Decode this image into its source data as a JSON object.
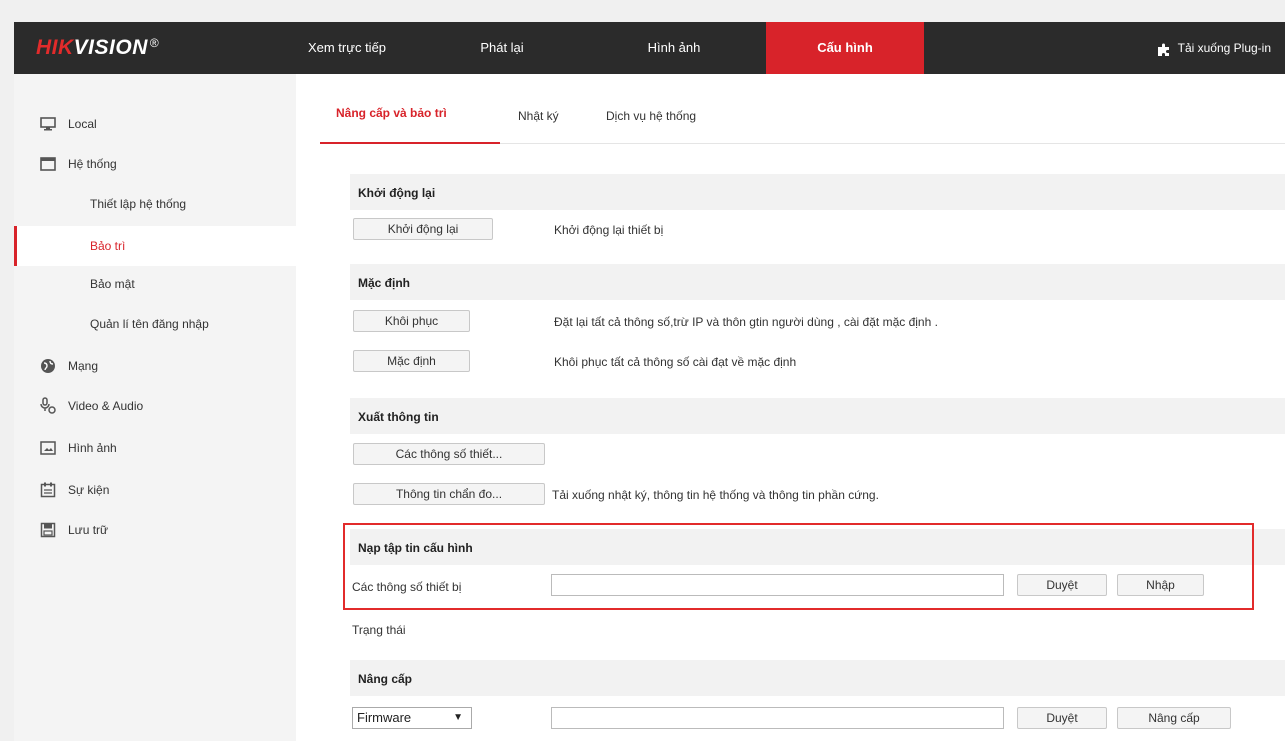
{
  "header": {
    "logo_red": "HIK",
    "logo_white": "VISION",
    "logo_mark": "®",
    "nav": [
      "Xem trực tiếp",
      "Phát lại",
      "Hình ảnh",
      "Cấu hình"
    ],
    "active_nav": "Cấu hình",
    "plugin_label": "Tải xuống Plug-in",
    "plugin_icon": "puzzle-icon"
  },
  "sidebar": {
    "items": [
      {
        "label": "Local",
        "icon": "monitor-icon"
      },
      {
        "label": "Hệ thống",
        "icon": "system-window-icon"
      },
      {
        "label": "Thiết lập hệ thống"
      },
      {
        "label": "Bảo trì"
      },
      {
        "label": "Bảo mật"
      },
      {
        "label": "Quản lí tên đăng nhập"
      },
      {
        "label": "Mạng",
        "icon": "globe-icon"
      },
      {
        "label": "Video & Audio",
        "icon": "audio-video-icon"
      },
      {
        "label": "Hình ảnh",
        "icon": "image-icon"
      },
      {
        "label": "Sự kiện",
        "icon": "calendar-icon"
      },
      {
        "label": "Lưu trữ",
        "icon": "storage-icon"
      }
    ],
    "selected": "Bảo trì"
  },
  "tabs": [
    "Nâng cấp và bảo trì",
    "Nhật ký",
    "Dịch vụ hệ thống"
  ],
  "sections": {
    "reboot": {
      "title": "Khởi động lại",
      "button": "Khởi động lại",
      "desc": "Khởi động lại thiết bị"
    },
    "default": {
      "title": "Mặc định",
      "restore_button": "Khôi phục",
      "restore_desc": "Đặt lại tất cả thông số,trừ IP và thôn gtin người dùng , cài đặt mặc định .",
      "default_button": "Mặc định",
      "default_desc": "Khôi phục tất cả thông số cài đạt về mặc định"
    },
    "export": {
      "title": "Xuất thông tin",
      "params_button": "Các thông số thiết...",
      "diag_button": "Thông tin chẩn đo...",
      "diag_desc": "Tải xuống nhật ký, thông tin hệ thống và thông tin phần cứng."
    },
    "import": {
      "title": "Nạp tập tin cấu hình",
      "label": "Các thông số thiết bị",
      "value": "",
      "browse_button": "Duyệt",
      "import_button": "Nhập",
      "status_label": "Trạng thái"
    },
    "upgrade": {
      "title": "Nâng cấp",
      "type_selected": "Firmware",
      "value": "",
      "browse_button": "Duyệt",
      "upgrade_button": "Nâng cấp"
    }
  },
  "colors": {
    "accent": "#d8232a",
    "header_bg": "#2b2b2b",
    "highlight_border": "#e22b2b"
  }
}
